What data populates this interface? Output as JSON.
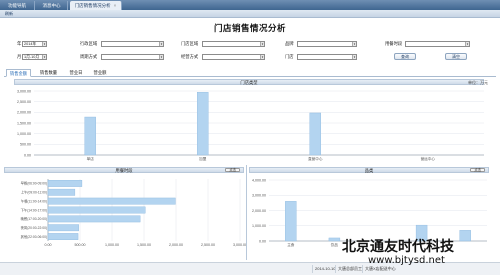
{
  "tabs": [
    {
      "label": "功能导航",
      "closable": false,
      "active": false
    },
    {
      "label": "消息中心",
      "closable": true,
      "active": false
    },
    {
      "label": "门店销售情况分析",
      "closable": true,
      "active": true
    }
  ],
  "toolbar": {
    "refresh_label": "刷新"
  },
  "page": {
    "title": "门店销售情况分析"
  },
  "filters": {
    "year": {
      "label": "年",
      "value": "2014年"
    },
    "month": {
      "label": "月",
      "value": "1月-10月"
    },
    "admin_region": {
      "label": "行政区域",
      "value": ""
    },
    "period_method": {
      "label": "周期方式",
      "value": ""
    },
    "store_region": {
      "label": "门店区域",
      "value": ""
    },
    "business_mode": {
      "label": "经营方式",
      "value": ""
    },
    "category": {
      "label": "品牌",
      "value": ""
    },
    "store": {
      "label": "门店",
      "value": ""
    },
    "time_slot": {
      "label": "用餐时段",
      "value": ""
    },
    "query_label": "查询",
    "clear_label": "清空"
  },
  "subtabs": [
    "销售金额",
    "销售数量",
    "营业日",
    "营业额"
  ],
  "unit_label": "单位：万元",
  "panels": {
    "store_type": "门店类型",
    "time_period": "用餐时段",
    "category": "品类",
    "button_label": "点击"
  },
  "status": {
    "date": "2014-10-10",
    "user": "大唐总部员工",
    "company": "大唐X店配送中心"
  },
  "watermark": {
    "line1": "北京通友时代科技",
    "line2": "www.bjtysd.net"
  },
  "chart_data": [
    {
      "type": "bar",
      "title": "门店类型",
      "categories": [
        "单店",
        "加盟",
        "直营中心",
        "营运中心"
      ],
      "values": [
        1780,
        2940,
        1970,
        0
      ],
      "ylim": [
        0,
        3000
      ],
      "yticks": [
        "0.00",
        "500.00",
        "1,000.00",
        "1,500.00",
        "2,000.00",
        "2,500.00",
        "3,000.00"
      ],
      "grid": true
    },
    {
      "type": "bar",
      "orientation": "horizontal",
      "title": "用餐时段",
      "categories": [
        "早餐(06:00-09:00)",
        "上午(09:00-11:00)",
        "午餐(11:00-14:00)",
        "下午(14:00-17:00)",
        "晚餐(17:00-20:00)",
        "夜宵(20:00-22:00)",
        "其他(22:00-06:00)"
      ],
      "values": [
        530,
        420,
        1990,
        1520,
        1440,
        480,
        470
      ],
      "xlim": [
        0,
        3000
      ],
      "xticks": [
        "0.00",
        "500.00",
        "1,000.00",
        "1,500.00",
        "2,000.00",
        "2,500.00",
        "3,000.00"
      ],
      "grid": true
    },
    {
      "type": "bar",
      "title": "品类",
      "categories": [
        "主食",
        "饮品",
        "",
        "",
        ""
      ],
      "values": [
        2600,
        200,
        0,
        1040,
        700
      ],
      "ylim": [
        0,
        4000
      ],
      "yticks": [
        "0.00",
        "1,000.00",
        "2,000.00",
        "3,000.00",
        "4,000.00"
      ],
      "grid": true
    }
  ]
}
